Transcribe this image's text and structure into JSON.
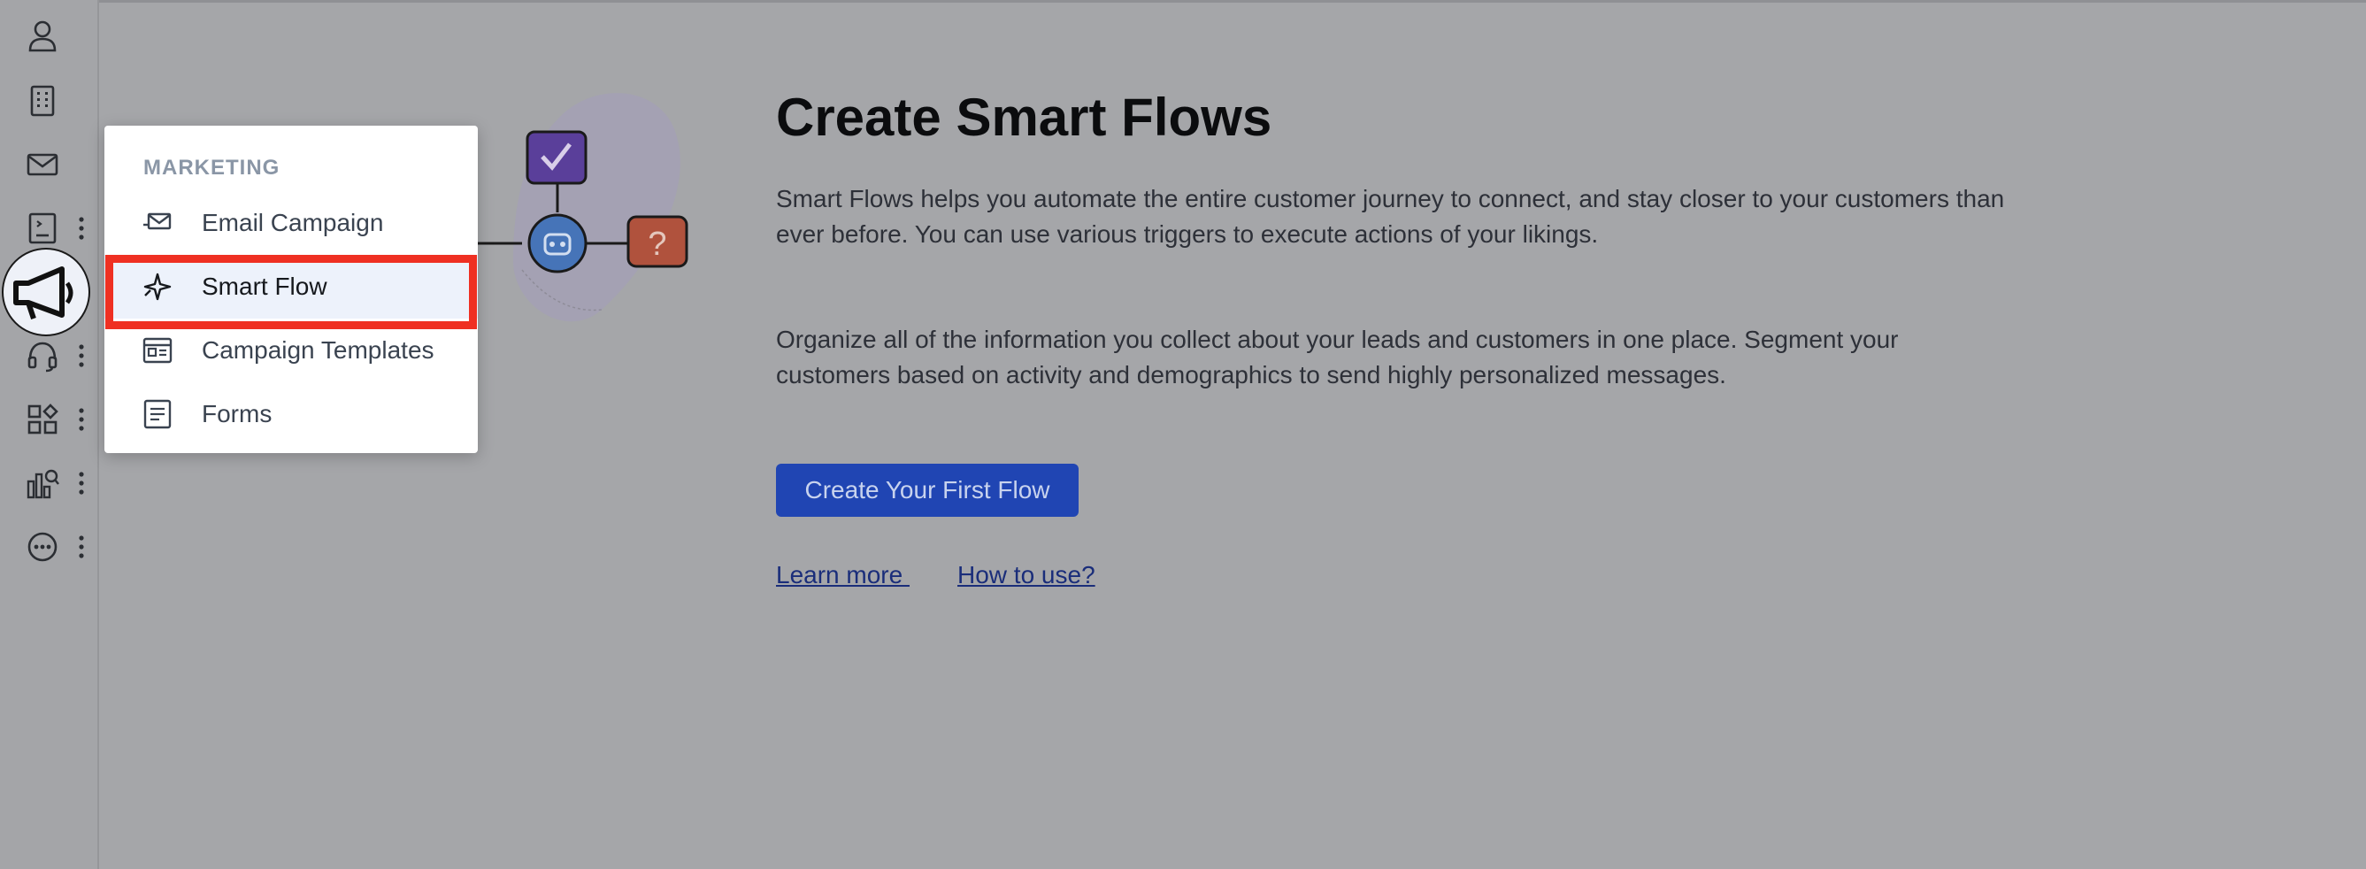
{
  "sidebar": {
    "items": [
      {
        "icon": "user-icon"
      },
      {
        "icon": "building-icon"
      },
      {
        "icon": "mail-icon"
      },
      {
        "icon": "book-icon"
      },
      {
        "icon": "megaphone-icon",
        "active": true
      },
      {
        "icon": "headset-icon"
      },
      {
        "icon": "apps-icon"
      },
      {
        "icon": "analytics-icon"
      },
      {
        "icon": "more-icon"
      }
    ]
  },
  "menu": {
    "header": "MARKETING",
    "items": [
      {
        "label": "Email Campaign",
        "icon": "email-campaign-icon"
      },
      {
        "label": "Smart Flow",
        "icon": "sparkle-icon",
        "selected": true
      },
      {
        "label": "Campaign Templates",
        "icon": "template-icon"
      },
      {
        "label": "Forms",
        "icon": "form-icon"
      }
    ]
  },
  "main": {
    "title": "Create Smart Flows",
    "description_1": "Smart Flows helps you automate the entire customer journey to connect, and stay closer to your customers than",
    "description_1b": "ever before. You can use various triggers to execute actions of your likings.",
    "description_2": "Organize all of the information you collect about your leads and customers in one place. Segment your",
    "description_2b": "customers based on activity and demographics to send highly personalized messages.",
    "cta_label": "Create Your First Flow",
    "learn_more_label": "Learn more ",
    "how_to_use_label": "How to use?"
  },
  "colors": {
    "highlight": "#ef3022",
    "cta": "#2045b3",
    "overlay": "#a5a6a9"
  }
}
